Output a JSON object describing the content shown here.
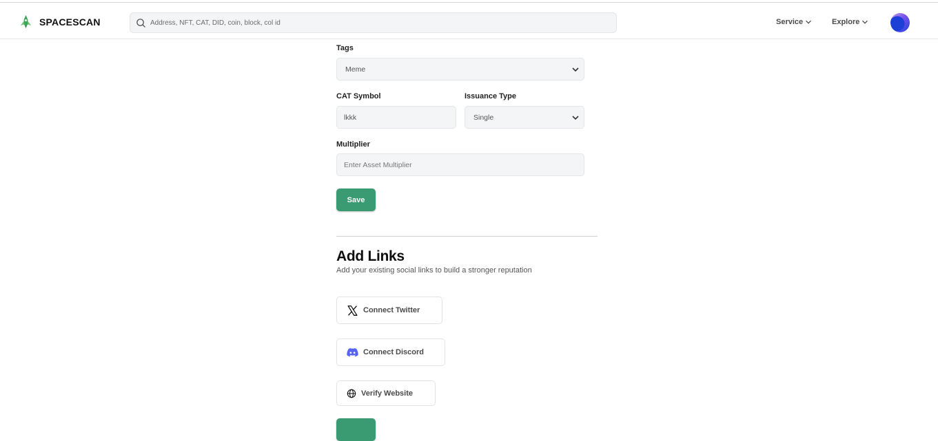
{
  "header": {
    "brand": "SPACESCAN",
    "search_placeholder": "Address, NFT, CAT, DID, coin, block, col id",
    "nav": [
      {
        "label": "Service"
      },
      {
        "label": "Explore"
      }
    ]
  },
  "form": {
    "tags_label": "Tags",
    "tags_value": "Meme",
    "cat_symbol_label": "CAT Symbol",
    "cat_symbol_value": "lkkk",
    "issuance_label": "Issuance Type",
    "issuance_value": "Single",
    "multiplier_label": "Multiplier",
    "multiplier_placeholder": "Enter Asset Multiplier",
    "save_label": "Save"
  },
  "links": {
    "title": "Add Links",
    "subtitle": "Add your existing social links to build a stronger reputation",
    "buttons": [
      {
        "label": "Connect Twitter",
        "icon": "x-twitter-icon"
      },
      {
        "label": "Connect Discord",
        "icon": "discord-icon"
      },
      {
        "label": "Verify Website",
        "icon": "globe-icon"
      }
    ]
  },
  "colors": {
    "accent": "#3a9a72",
    "discord": "#5865f2"
  }
}
